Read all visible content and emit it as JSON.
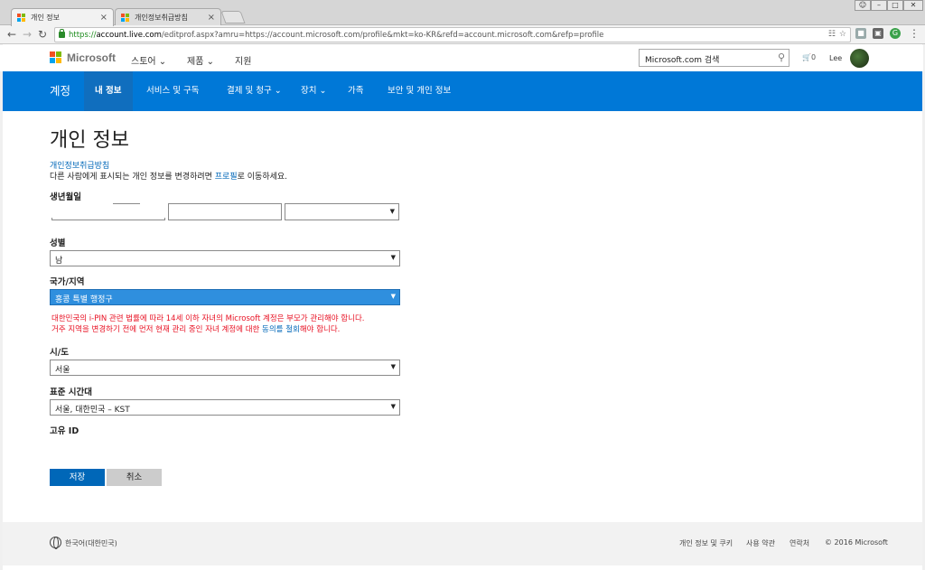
{
  "browser": {
    "tabs": [
      {
        "title": "개인 정보",
        "active": true
      },
      {
        "title": "개인정보취급방침",
        "active": false
      }
    ],
    "close_glyph": "×",
    "url_scheme": "https://",
    "url_host": "account.live.com",
    "url_rest": "/editprof.aspx?amru=https://account.microsoft.com/profile&mkt=ko-KR&refd=account.microsoft.com&refp=profile",
    "back_icon": "arrow-left-icon",
    "forward_icon": "arrow-right-icon",
    "reload_icon": "reload-icon"
  },
  "header": {
    "logo_text": "Microsoft",
    "logo_colors": [
      "#f25022",
      "#7fba00",
      "#00a4ef",
      "#ffb900"
    ],
    "nav": [
      {
        "label": "스토어 ⌄"
      },
      {
        "label": "제품 ⌄"
      },
      {
        "label": "지원"
      }
    ],
    "search_placeholder": "Microsoft.com 검색",
    "cart_count": "0",
    "user_name": "Lee"
  },
  "bluebar": {
    "brand": "계정",
    "items": [
      {
        "label": "내 정보",
        "active": true
      },
      {
        "label": "서비스 및 구독"
      },
      {
        "label": "결제 및 청구 ⌄"
      },
      {
        "label": "장치 ⌄"
      },
      {
        "label": "가족"
      },
      {
        "label": "보안 및 개인 정보"
      }
    ],
    "accent": "#0078d7"
  },
  "content": {
    "title": "개인 정보",
    "privacy_link": "개인정보취급방침",
    "profile_note_before": "다른 사람에게 표시되는 개인 정보를 변경하려면 ",
    "profile_note_link": "프로필",
    "profile_note_after": "로 이동하세요.",
    "fields": {
      "dob_label": "생년월일",
      "gender_label": "성별",
      "gender_value": "남",
      "country_label": "국가/지역",
      "country_value": "홍콩 특별 행정구",
      "warning_line1": "대한민국의 i-PIN 관련 법률에 따라 14세 이하 자녀의 Microsoft 계정은 부모가 관리해야 합니다.",
      "warning_line2_before": "거주 지역을 변경하기 전에 먼저 현재 관리 중인 자녀 계정에 대한 ",
      "warning_line2_link": "동의를 철회",
      "warning_line2_after": "해야 합니다.",
      "city_label": "시/도",
      "city_value": "서울",
      "timezone_label": "표준 시간대",
      "timezone_value": "서울, 대한민국 – KST",
      "uid_label": "고유 ID"
    },
    "save_label": "저장",
    "cancel_label": "취소"
  },
  "footer": {
    "language": "한국어(대한민국)",
    "links": [
      "개인 정보 및 쿠키",
      "사용 약관",
      "연락처"
    ],
    "copyright": "© 2016 Microsoft"
  }
}
